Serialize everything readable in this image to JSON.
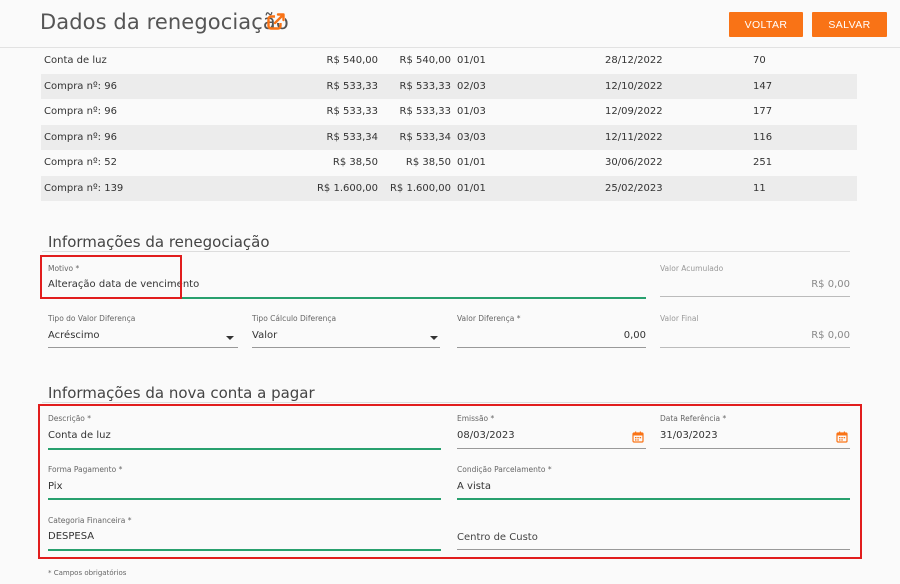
{
  "header": {
    "title": "Dados da renegociação",
    "back_label": "VOLTAR",
    "save_label": "SALVAR",
    "accent_color": "#f97316",
    "title_icon": "external-link-icon"
  },
  "table": {
    "rows": [
      {
        "desc": "Conta de luz",
        "v1": "R$ 540,00",
        "v2": "R$ 540,00",
        "parc": "01/01",
        "date": "28/12/2022",
        "days": "70"
      },
      {
        "desc": "Compra nº: 96",
        "v1": "R$ 533,33",
        "v2": "R$ 533,33",
        "parc": "02/03",
        "date": "12/10/2022",
        "days": "147"
      },
      {
        "desc": "Compra nº: 96",
        "v1": "R$ 533,33",
        "v2": "R$ 533,33",
        "parc": "01/03",
        "date": "12/09/2022",
        "days": "177"
      },
      {
        "desc": "Compra nº: 96",
        "v1": "R$ 533,34",
        "v2": "R$ 533,34",
        "parc": "03/03",
        "date": "12/11/2022",
        "days": "116"
      },
      {
        "desc": "Compra nº: 52",
        "v1": "R$ 38,50",
        "v2": "R$ 38,50",
        "parc": "01/01",
        "date": "30/06/2022",
        "days": "251"
      },
      {
        "desc": "Compra nº: 139",
        "v1": "R$ 1.600,00",
        "v2": "R$ 1.600,00",
        "parc": "01/01",
        "date": "25/02/2023",
        "days": "11"
      }
    ]
  },
  "renegotiation": {
    "section_title": "Informações da renegociação",
    "motivo": {
      "label": "Motivo *",
      "value": "Alteração data de vencimento"
    },
    "valor_acumulado": {
      "label": "Valor Acumulado",
      "value": "R$ 0,00"
    },
    "tipo_valor_diferenca": {
      "label": "Tipo do Valor Diferença",
      "value": "Acréscimo"
    },
    "tipo_calculo_diferenca": {
      "label": "Tipo Cálculo Diferença",
      "value": "Valor"
    },
    "valor_diferenca": {
      "label": "Valor Diferença *",
      "value": "0,00"
    },
    "valor_final": {
      "label": "Valor Final",
      "value": "R$ 0,00"
    }
  },
  "new_payable": {
    "section_title": "Informações da nova conta a pagar",
    "descricao": {
      "label": "Descrição *",
      "value": "Conta de luz"
    },
    "emissao": {
      "label": "Emissão *",
      "value": "08/03/2023"
    },
    "data_referencia": {
      "label": "Data Referência *",
      "value": "31/03/2023"
    },
    "forma_pagamento": {
      "label": "Forma Pagamento *",
      "value": "Pix"
    },
    "condicao_parcelamento": {
      "label": "Condição Parcelamento *",
      "value": "A vista"
    },
    "categoria_financeira": {
      "label": "Categoria Financeira *",
      "value": "DESPESA"
    },
    "centro_custo": {
      "placeholder": "Centro de Custo"
    }
  },
  "footnote": "* Campos obrigatórios"
}
